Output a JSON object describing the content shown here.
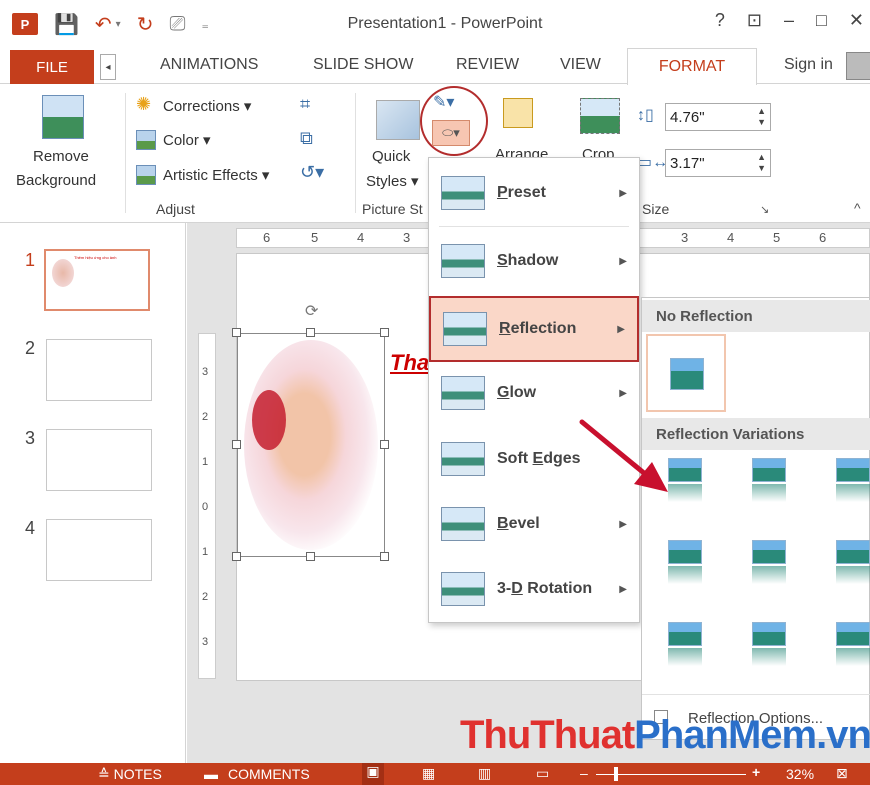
{
  "app": {
    "logo_text": "P",
    "window_title": "Presentation1 - PowerPoint",
    "controls": {
      "help": "?",
      "restore_ribbon": "⊡",
      "minimize": "–",
      "maximize": "□",
      "close": "✕"
    }
  },
  "tabs": {
    "file": "FILE",
    "scroll_left": "◂",
    "items": [
      "ANIMATIONS",
      "SLIDE SHOW",
      "REVIEW",
      "VIEW"
    ],
    "active": "FORMAT",
    "sign_in": "Sign in"
  },
  "ribbon": {
    "remove_background_line1": "Remove",
    "remove_background_line2": "Background",
    "corrections": "Corrections ▾",
    "color": "Color ▾",
    "artistic_effects": "Artistic Effects ▾",
    "adjust_group": "Adjust",
    "quick_styles_line1": "Quick",
    "quick_styles_line2": "Styles ▾",
    "picture_styles_group": "Picture St",
    "arrange": "Arrange",
    "crop": "Crop",
    "height_value": "4.76\"",
    "width_value": "3.17\"",
    "size_group": "Size",
    "size_launcher": "↘",
    "collapse": "^"
  },
  "slides": {
    "numbers": [
      "1",
      "2",
      "3",
      "4"
    ],
    "thumb1_title": "Thêm hiệu ứng cho ảnh"
  },
  "ruler": {
    "h_left": [
      "6",
      "5",
      "4",
      "3"
    ],
    "h_right": [
      "3",
      "4",
      "5",
      "6"
    ],
    "v": [
      "3",
      "2",
      "1",
      "0",
      "1",
      "2",
      "3"
    ]
  },
  "slide": {
    "title_fragment": "Tha"
  },
  "effects_menu": {
    "items": [
      {
        "label": "Preset",
        "accel": "P",
        "rest": "reset"
      },
      {
        "label": "Shadow",
        "accel": "S",
        "rest": "hadow"
      },
      {
        "label": "Reflection",
        "accel": "R",
        "rest": "eflection"
      },
      {
        "label": "Glow",
        "accel": "G",
        "rest": "low"
      },
      {
        "label": "Soft Edges",
        "pre": "Soft ",
        "accel": "E",
        "rest": "dges"
      },
      {
        "label": "Bevel",
        "accel": "B",
        "rest": "evel"
      },
      {
        "label": "3-D Rotation",
        "pre": "3-",
        "accel": "D",
        "rest": " Rotation"
      }
    ],
    "arrow": "▶"
  },
  "reflection_gallery": {
    "no_reflection": "No Reflection",
    "variations": "Reflection Variations",
    "options": "Reflection Options..."
  },
  "status": {
    "notes": "≙ NOTES",
    "comments": "COMMENTS",
    "zoom_minus": "–",
    "zoom_plus": "+",
    "zoom_level": "32%"
  },
  "watermark": {
    "part1": "ThuThuat",
    "part2": "PhanMem",
    "part3": ".vn"
  },
  "colors": {
    "brand": "#c43e1c",
    "highlight_border": "#b32d2d",
    "highlight_fill": "#fad7c8",
    "watermark_red": "#e0312f",
    "watermark_blue": "#2a6fc9"
  }
}
